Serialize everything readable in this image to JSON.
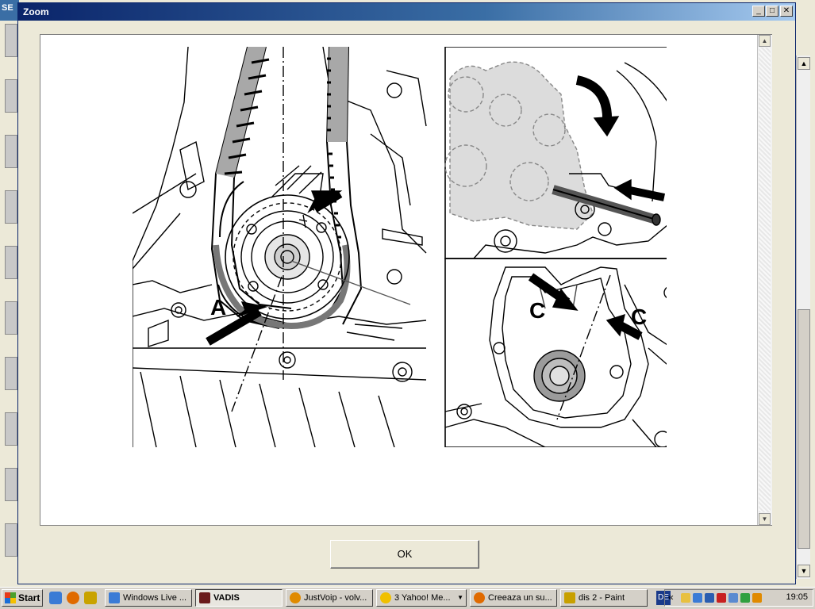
{
  "background_app": {
    "title_fragment": "SE"
  },
  "dialog": {
    "title": "Zoom",
    "controls": {
      "minimize": "_",
      "maximize": "□",
      "close": "✕"
    }
  },
  "figure": {
    "labels": {
      "a": "A",
      "c_left": "C",
      "c_right": "C"
    }
  },
  "ok_button": {
    "label": "OK"
  },
  "taskbar": {
    "start_label": "Start",
    "items": [
      {
        "label": "Windows Live ...",
        "color": "#3b7bd6",
        "active": false
      },
      {
        "label": "VADIS",
        "color": "#6a1b1b",
        "active": true
      },
      {
        "label": "JustVoip - volv...",
        "color": "#e08a00",
        "active": false
      },
      {
        "label": "3 Yahoo! Me...",
        "color": "#f0c000",
        "active": false
      },
      {
        "label": "Creeaza un su...",
        "color": "#e06a00",
        "active": false
      },
      {
        "label": "dis 2 - Paint",
        "color": "#c8a000",
        "active": false
      }
    ],
    "language": "DE",
    "tray_chevron": "«",
    "clock": "19:05"
  }
}
